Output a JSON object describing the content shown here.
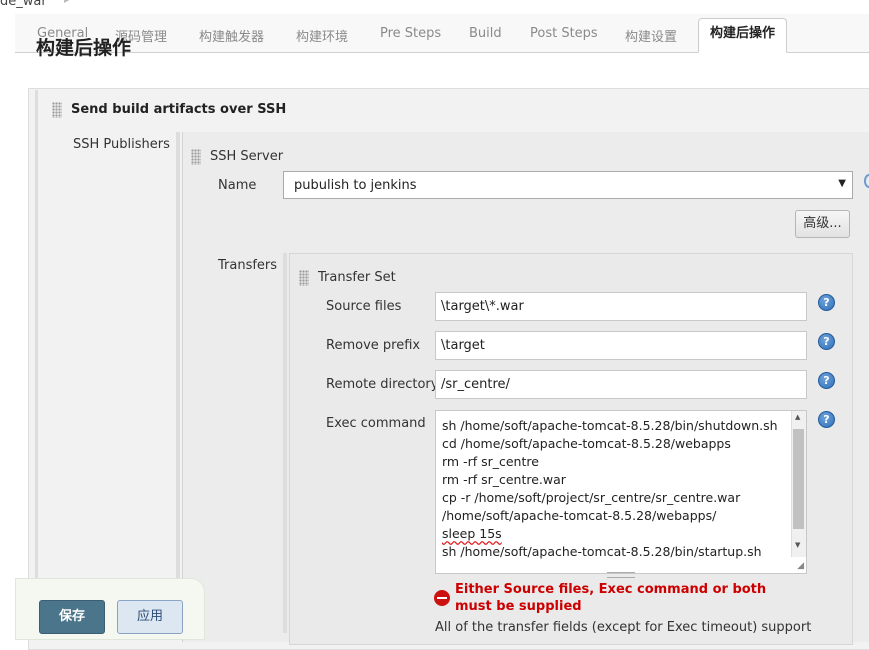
{
  "breadcrumb": {
    "text": "de_war"
  },
  "tabs": [
    "General",
    "源码管理",
    "构建触发器",
    "构建环境",
    "Pre Steps",
    "Build",
    "Post Steps",
    "构建设置",
    "构建后操作"
  ],
  "section": {
    "title": "构建后操作"
  },
  "publisher": {
    "title": "Send build artifacts over SSH",
    "publishers_label": "SSH Publishers"
  },
  "server": {
    "title": "SSH Server",
    "name_label": "Name",
    "name_value": "pubulish  to  jenkins",
    "advanced_label": "高级..."
  },
  "transfers": {
    "label": "Transfers",
    "set_title": "Transfer Set",
    "source_label": "Source files",
    "source_value": "\\target\\*.war",
    "prefix_label": "Remove prefix",
    "prefix_value": "\\target",
    "remote_label": "Remote directory",
    "remote_value": "/sr_centre/",
    "exec_label": "Exec command",
    "exec_lines": [
      "sh /home/soft/apache-tomcat-8.5.28/bin/shutdown.sh",
      "cd /home/soft/apache-tomcat-8.5.28/webapps",
      "rm -rf sr_centre",
      "rm -rf sr_centre.war",
      "cp -r /home/soft/project/sr_centre/sr_centre.war",
      "/home/soft/apache-tomcat-8.5.28/webapps/",
      "sleep 15s",
      "sh /home/soft/apache-tomcat-8.5.28/bin/startup.sh"
    ],
    "error": "Either Source files, Exec command or both must be supplied",
    "note": "All of the transfer fields (except for Exec timeout) support"
  },
  "buttons": {
    "save": "保存",
    "apply": "应用"
  },
  "help_glyph": "?"
}
